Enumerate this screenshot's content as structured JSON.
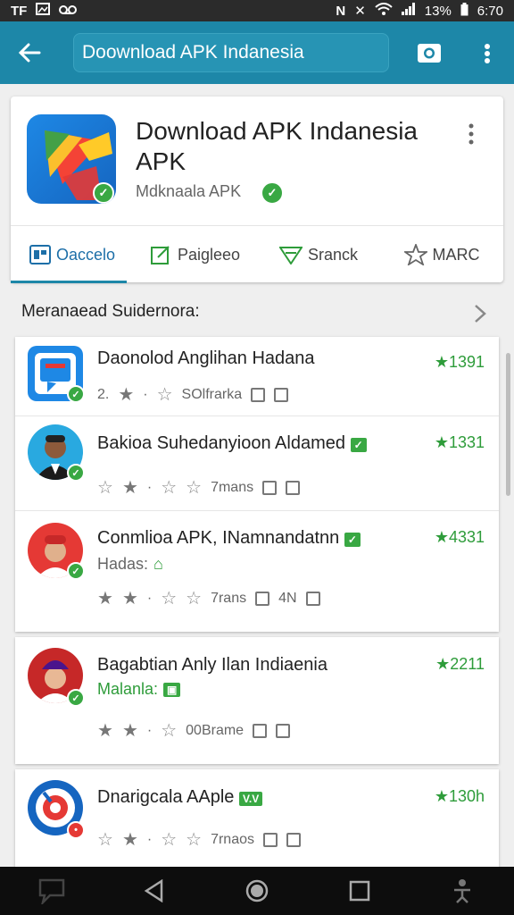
{
  "status_bar": {
    "left_icons": [
      "TF",
      "image-icon",
      "voicemail-icon"
    ],
    "right_text": "13%",
    "time": "6:70"
  },
  "toolbar": {
    "search_text": "Doownload APK Indanesia"
  },
  "app": {
    "title": "Download APK Indanesia APK",
    "developer": "Mdknaala APK",
    "tabs": [
      {
        "label": "Oaccelo",
        "icon": "apps-icon"
      },
      {
        "label": "Paigleeo",
        "icon": "edit-icon"
      },
      {
        "label": "Sranck",
        "icon": "signal-icon"
      },
      {
        "label": "MARC",
        "icon": "star-outline-icon"
      }
    ]
  },
  "section": {
    "title": "Meranaead Suidernora:"
  },
  "list": [
    {
      "title": "Daonolod Anglihan Hadana",
      "meta_prefix": "2.",
      "meta_text": "SOlfrarka",
      "score": "1391"
    },
    {
      "title": "Bakioa Suhedanyioon Aldamed",
      "meta_text": "7mans",
      "score": "1331"
    },
    {
      "title": "Conmlioa APK, INamnandatnn",
      "sub": "Hadas:",
      "meta_text": "7rans",
      "meta_extra": "4N",
      "score": "4331"
    },
    {
      "title": "Bagabtian Anly Ilan Indiaenia",
      "sub": "Malanla:",
      "meta_text": "00Brame",
      "score": "2211"
    },
    {
      "title": "Dnarigcala AAple",
      "badge": "V.V",
      "meta_text": "7rnaos",
      "score": "130h"
    }
  ],
  "colors": {
    "toolbar": "#1d87a8",
    "accent_green": "#39a843",
    "navbar": "#0d0d0d"
  }
}
